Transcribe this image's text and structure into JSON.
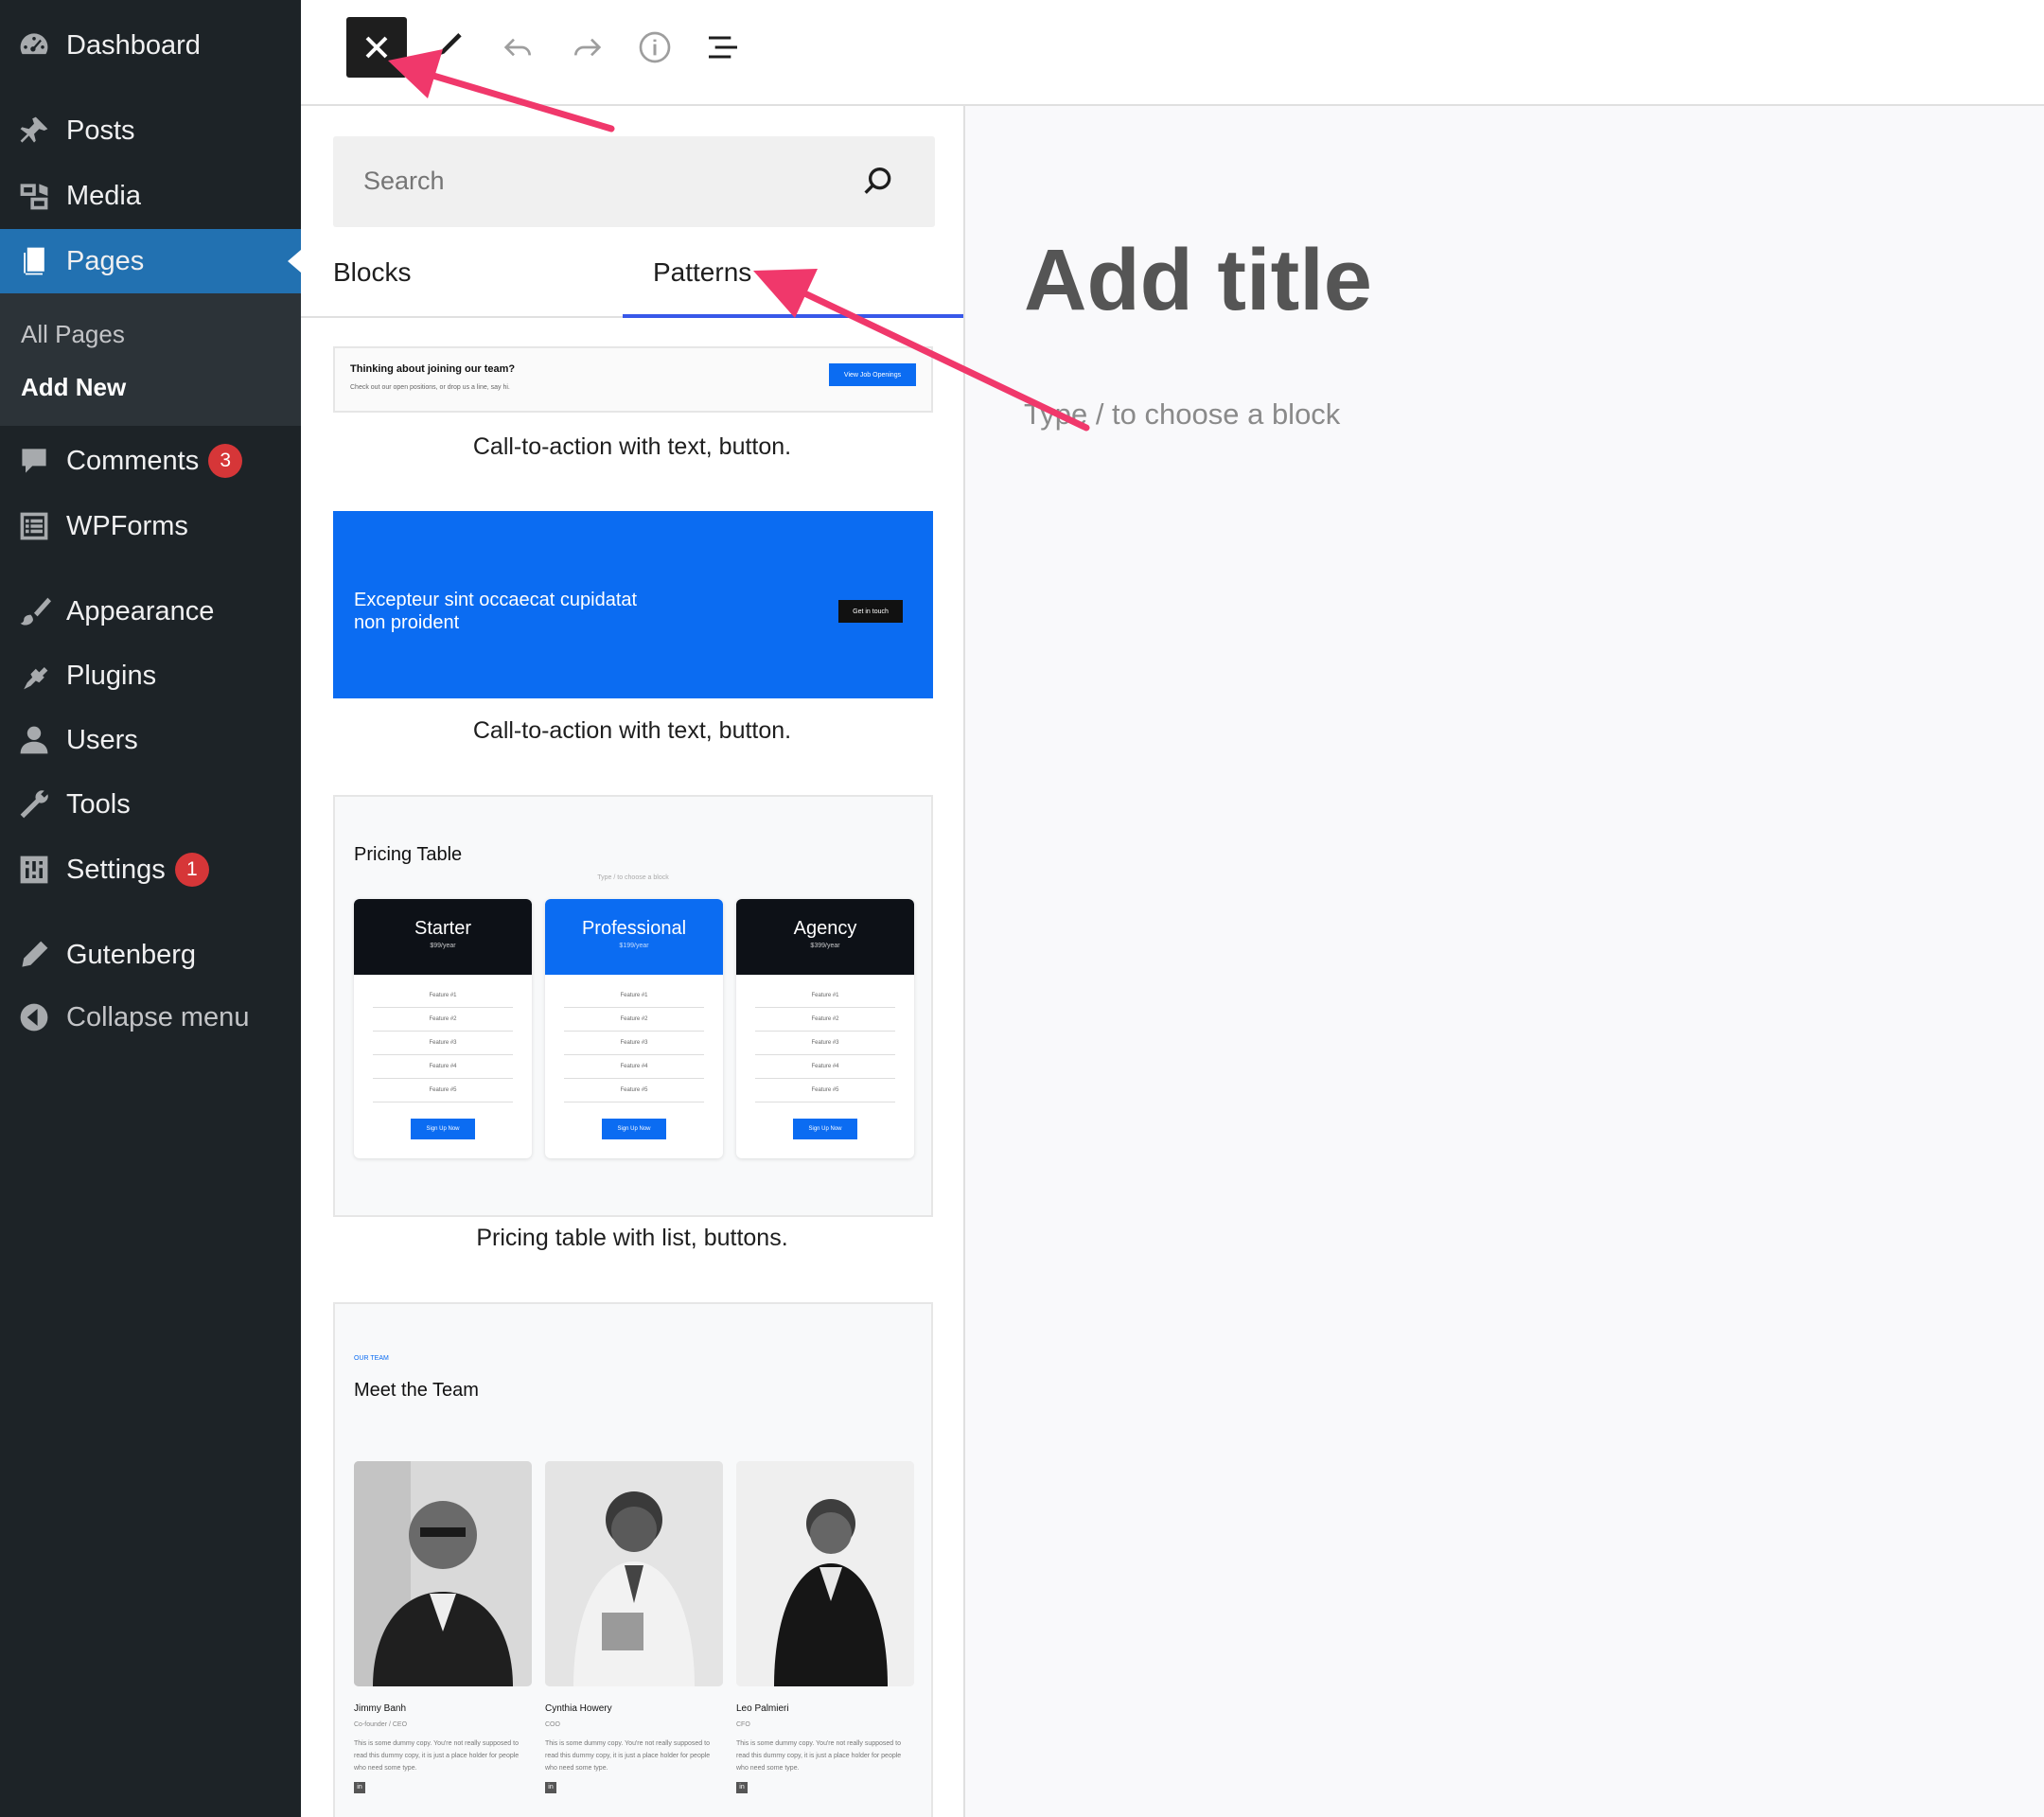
{
  "admin_menu": {
    "dashboard": "Dashboard",
    "posts": "Posts",
    "media": "Media",
    "pages": "Pages",
    "submenu": [
      "All Pages",
      "Add New"
    ],
    "comments": "Comments",
    "comments_badge": "3",
    "wpforms": "WPForms",
    "appearance": "Appearance",
    "plugins": "Plugins",
    "users": "Users",
    "tools": "Tools",
    "settings": "Settings",
    "settings_badge": "1",
    "gutenberg": "Gutenberg",
    "collapse": "Collapse menu"
  },
  "inserter": {
    "search_placeholder": "Search",
    "tabs": [
      "Blocks",
      "Patterns"
    ],
    "active_tab": "Patterns",
    "patterns": [
      {
        "caption": "Call-to-action with text, button.",
        "heading": "Thinking about joining our team?",
        "subtext": "Check out our open positions, or drop us a line, say hi.",
        "button": "View Job Openings"
      },
      {
        "caption": "Call-to-action with text, button.",
        "heading": "Excepteur sint occaecat cupidatat non proident",
        "button": "Get in touch"
      },
      {
        "caption": "Pricing table with list, buttons.",
        "heading": "Pricing Table",
        "hint": "Type / to choose a block",
        "plans": [
          {
            "name": "Starter",
            "price": "$99/year"
          },
          {
            "name": "Professional",
            "price": "$199/year"
          },
          {
            "name": "Agency",
            "price": "$399/year"
          }
        ],
        "features": [
          "Feature #1",
          "Feature #2",
          "Feature #3",
          "Feature #4",
          "Feature #5"
        ],
        "button": "Sign Up Now"
      },
      {
        "overline": "OUR TEAM",
        "heading": "Meet the Team",
        "members": [
          {
            "name": "Jimmy Banh",
            "role": "Co-founder / CEO"
          },
          {
            "name": "Cynthia Howery",
            "role": "COO"
          },
          {
            "name": "Leo Palmieri",
            "role": "CFO"
          }
        ],
        "bio": "This is some dummy copy. You're not really supposed to read this dummy copy, it is just a place holder for people who need some type."
      }
    ]
  },
  "canvas": {
    "title_placeholder": "Add title",
    "block_placeholder": "Type / to choose a block"
  },
  "colors": {
    "sidebar_bg": "#1d2327",
    "active_menu": "#2271b1",
    "badge": "#d63638",
    "pattern_blue": "#0b6cf2",
    "annotation_arrow": "#f0386b"
  },
  "icons": {
    "toolbar": [
      "close-icon",
      "pencil-icon",
      "undo-icon",
      "redo-icon",
      "info-icon",
      "list-view-icon"
    ],
    "search": "search-icon"
  }
}
